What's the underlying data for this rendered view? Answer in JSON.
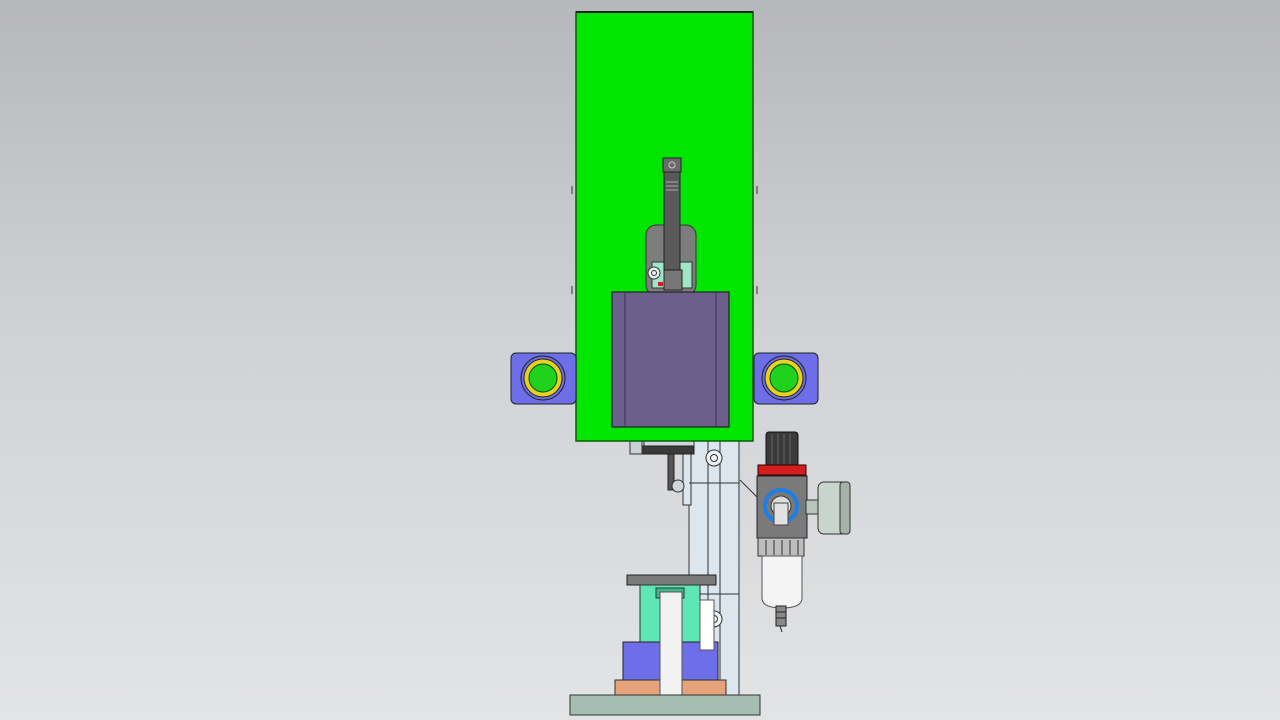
{
  "viewport": {
    "kind": "cad-3d-model-view"
  },
  "colors": {
    "guard": "#00e600",
    "guard_edge": "#0a5a0a",
    "motor": "#6c5f8c",
    "bracket": "#6e6ee8",
    "button_green": "#1ed21e",
    "button_ring": "#e6d21e",
    "column": "#dbe6ee",
    "mint": "#5ee6b4",
    "copper": "#e6a27a",
    "base": "#a6bdb2",
    "regulator_red": "#d21e1e",
    "regulator_blue": "#1e7ee6",
    "dark_steel": "#444444"
  },
  "parts": {
    "guard": "green-safety-guard",
    "motor": "motor-housing",
    "left_button": "left-start-button",
    "right_button": "right-start-button",
    "actuator": "actuator-rod",
    "column": "vertical-column",
    "regulator": "air-filter-regulator",
    "gauge": "pressure-gauge",
    "fixture": "fixture-block",
    "base": "base-plate"
  }
}
